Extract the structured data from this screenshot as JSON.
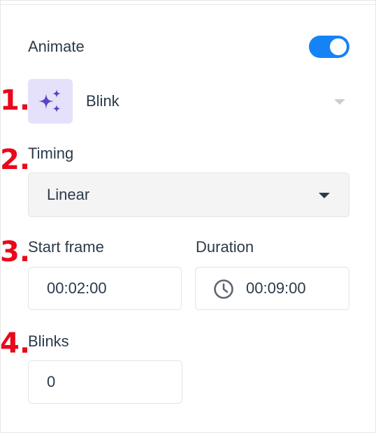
{
  "animate": {
    "label": "Animate",
    "enabled": true,
    "accent_color": "#1583f5"
  },
  "effect": {
    "icon": "sparkles-icon",
    "name": "Blink"
  },
  "timing": {
    "label": "Timing",
    "value": "Linear"
  },
  "start_frame": {
    "label": "Start frame",
    "value": "00:02:00"
  },
  "duration": {
    "label": "Duration",
    "icon": "clock-icon",
    "value": "00:09:00"
  },
  "blinks": {
    "label": "Blinks",
    "value": "0"
  },
  "annotations": [
    "1.",
    "2.",
    "3.",
    "4."
  ]
}
